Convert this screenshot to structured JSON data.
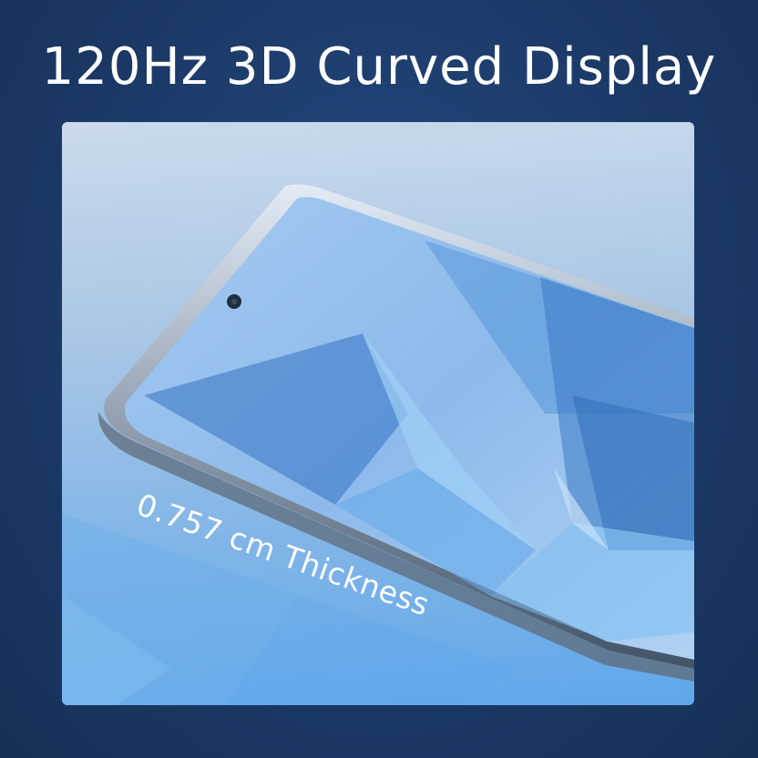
{
  "headline": "120Hz 3D Curved Display",
  "callout": "0.757 cm Thickness",
  "colors": {
    "background": "#1d3d6c",
    "panel_top": "#c9d8ea",
    "panel_bottom": "#5da6ea",
    "text": "#ffffff"
  }
}
